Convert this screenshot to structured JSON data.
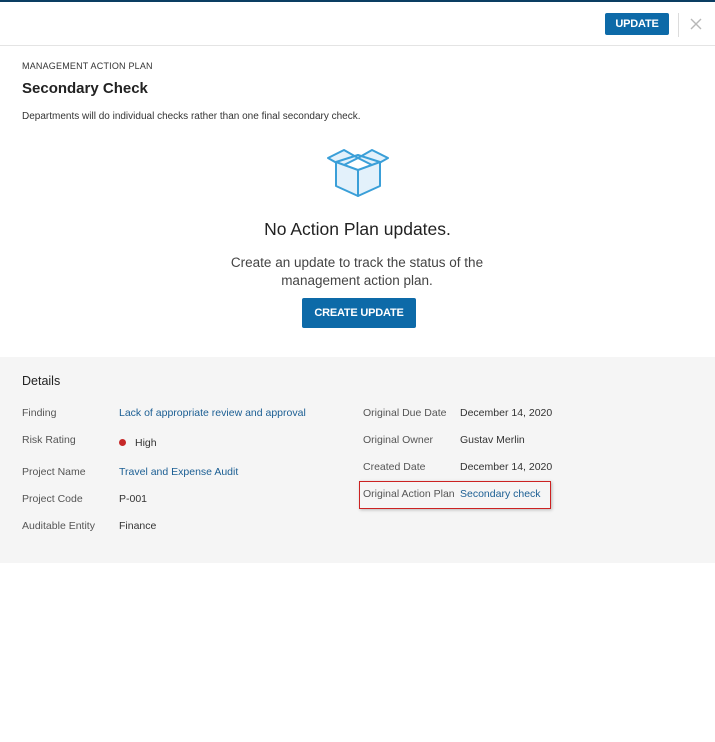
{
  "header": {
    "update_label": "UPDATE",
    "close_icon": "close-icon"
  },
  "plan": {
    "eyebrow": "MANAGEMENT ACTION PLAN",
    "title": "Secondary Check",
    "description": "Departments will do individual checks rather than one final secondary check."
  },
  "empty_state": {
    "icon": "open-box-icon",
    "title": "No Action Plan updates.",
    "subtitle": "Create an update to track the status of the management action plan.",
    "create_label": "CREATE UPDATE"
  },
  "details": {
    "heading": "Details",
    "finding_label": "Finding",
    "finding_value": "Lack of appropriate review and approval",
    "risk_label": "Risk Rating",
    "risk_value": "High",
    "risk_color": "#c62828",
    "project_name_label": "Project Name",
    "project_name_value": "Travel and Expense Audit",
    "project_code_label": "Project Code",
    "project_code_value": "P-001",
    "entity_label": "Auditable Entity",
    "entity_value": "Finance",
    "due_label": "Original Due Date",
    "due_value": "December 14, 2020",
    "owner_label": "Original Owner",
    "owner_value": "Gustav Merlin",
    "created_label": "Created Date",
    "created_value": "December 14, 2020",
    "orig_plan_label": "Original Action Plan",
    "orig_plan_value": "Secondary check"
  },
  "colors": {
    "accent": "#0d6aa8",
    "link": "#1b5e93",
    "highlight": "#cc2222",
    "panel": "#f5f5f5"
  }
}
